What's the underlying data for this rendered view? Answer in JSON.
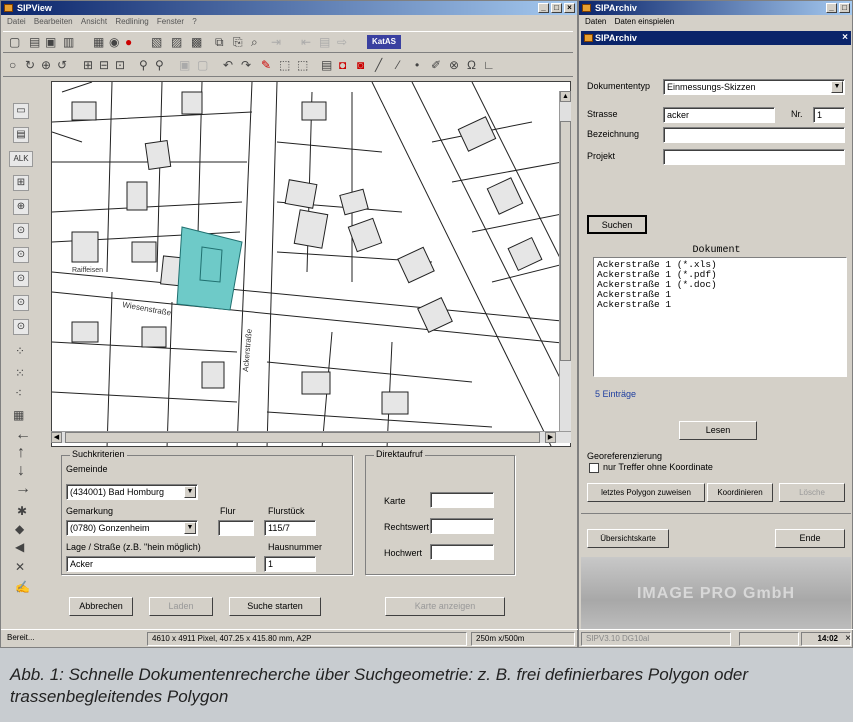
{
  "sipview": {
    "title": "SIPView",
    "menu": [
      "Datei",
      "Bearbeiten",
      "Ansicht",
      "Redlining",
      "Fenster",
      "?"
    ],
    "katas_label": "KatAS",
    "search_panel": {
      "title": "Suchkriterien",
      "gemeinde_label": "Gemeinde",
      "gemeinde_value": "(434001) Bad Homburg",
      "gemarkung_label": "Gemarkung",
      "gemarkung_value": "(0780) Gonzenheim",
      "flur_label": "Flur",
      "flur_value": "",
      "flurstueck_label": "Flurstück",
      "flurstueck_value": "115/7",
      "lage_label": "Lage / Straße (z.B. \"hein möglich)",
      "lage_value": "Acker",
      "hausnummer_label": "Hausnummer",
      "hausnummer_value": "1",
      "abbrechen": "Abbrechen",
      "laden": "Laden",
      "suche_starten": "Suche starten"
    },
    "direkt_panel": {
      "title": "Direktaufruf",
      "karte_label": "Karte",
      "rechtswert_label": "Rechtswert",
      "hochwert_label": "Hochwert",
      "karte_anzeigen": "Karte anzeigen"
    },
    "status": {
      "ready": "Bereit...",
      "pixel_info": "4610 x 4911 Pixel, 407.25 x 415.80 mm, A2P",
      "scale": "250m x/500m",
      "code": "SIPV3.10 DG10al",
      "time": "14:02"
    },
    "map_labels": {
      "street1": "Ackerstraße",
      "street2": "Wiesenstraße",
      "street3": "Raiffeisen"
    }
  },
  "siparchiv": {
    "title": "SIPArchiv",
    "menu": [
      "Daten",
      "Daten einspielen"
    ],
    "inner_title": "SIPArchiv",
    "dokumententyp_label": "Dokumententyp",
    "dokumententyp_value": "Einmessungs-Skizzen",
    "strasse_label": "Strasse",
    "strasse_value": "acker",
    "nr_label": "Nr.",
    "nr_value": "1",
    "bezeichnung_label": "Bezeichnung",
    "projekt_label": "Projekt",
    "suchen": "Suchen",
    "list_header": "Dokument",
    "documents": [
      "Ackerstraße 1 (*.xls)",
      "Ackerstraße 1 (*.pdf)",
      "Ackerstraße 1 (*.doc)",
      "Ackerstraße 1",
      "Ackerstraße 1"
    ],
    "count": "5 Einträge",
    "loeschen": "Lesen",
    "georef_title": "Georeferenzierung",
    "checkbox_label": "nur Treffer ohne Koordinate",
    "letztes_polygon": "letztes Polygon zuweisen",
    "koordinieren": "Koordinieren",
    "loeschen2": "Lösche",
    "uebersicht": "Übersichtskarte",
    "ende": "Ende",
    "logo": "IMAGE PRO GmbH"
  },
  "caption": "Abb. 1: Schnelle Dokumentenrecherche über Suchgeometrie: z. B. frei definierbares Polygon oder trassenbegleitendes Polygon",
  "colors": {
    "titlebar": "#0a246a",
    "parcel_highlight": "#6ecac8",
    "caption_bg": "#c8ccd0"
  }
}
